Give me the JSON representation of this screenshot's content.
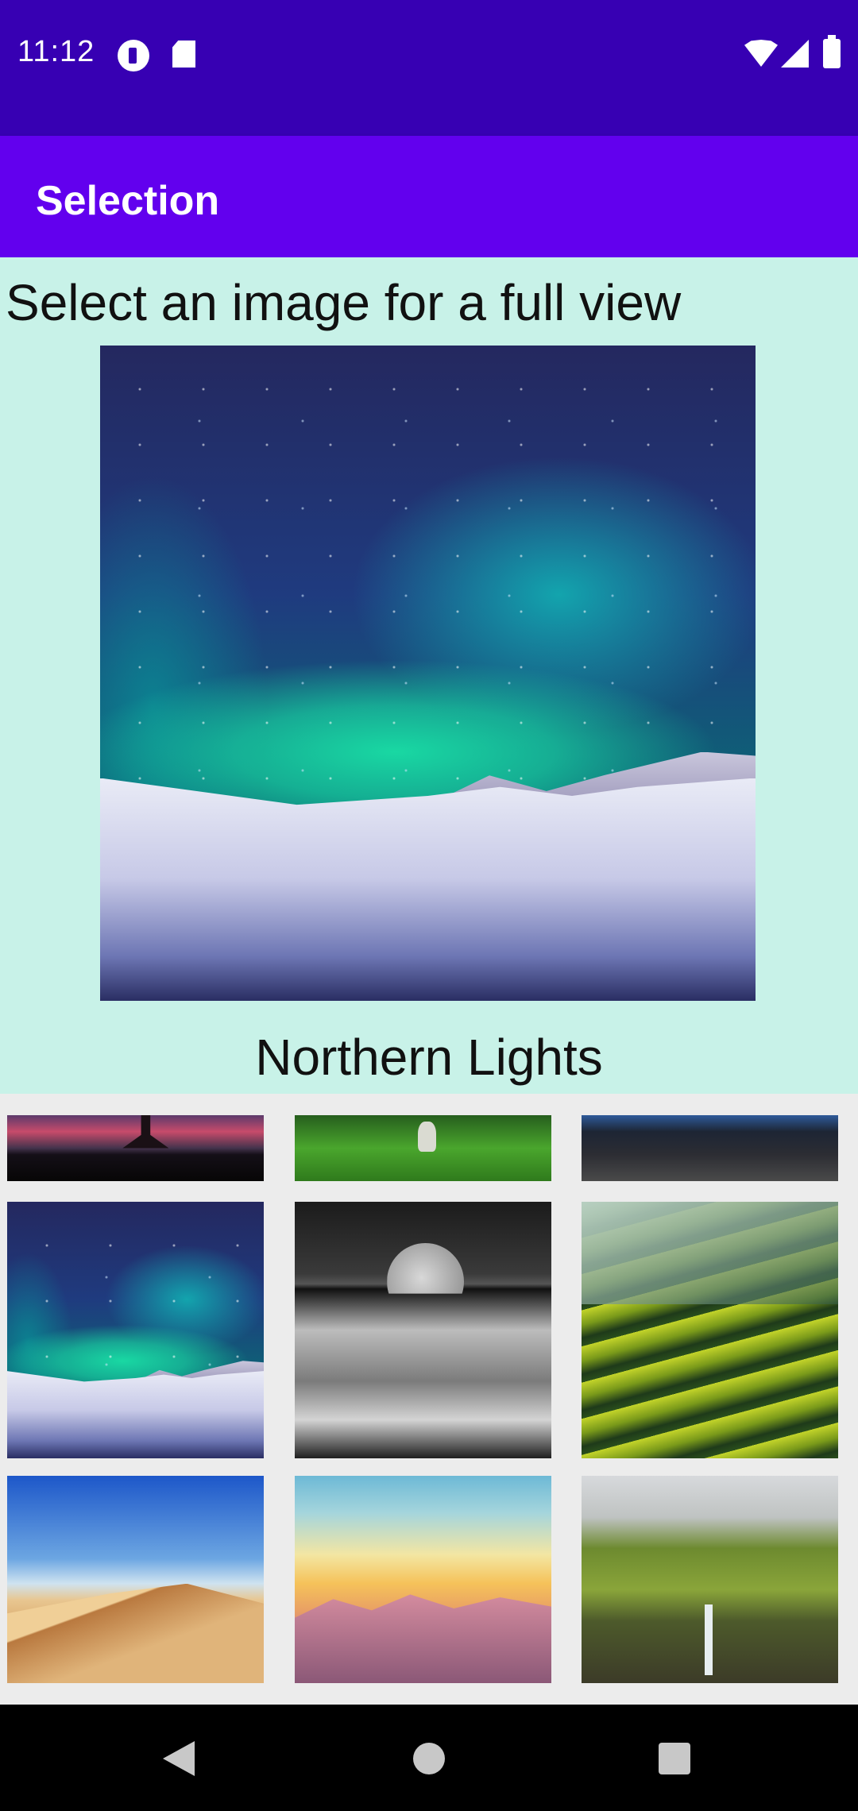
{
  "status_bar": {
    "time": "11:12",
    "icons": [
      "notification-app-icon",
      "sd-card-icon",
      "wifi-icon",
      "cell-signal-icon",
      "battery-icon"
    ]
  },
  "app_bar": {
    "title": "Selection",
    "color": "#6200ee",
    "status_color": "#3700b3"
  },
  "content": {
    "prompt": "Select an image for a full view",
    "selected_caption": "Northern Lights",
    "background": "#c8f2e8"
  },
  "gallery": {
    "rows": [
      [
        "sunset-silhouette",
        "green-forest",
        "rocky-shore"
      ],
      [
        "northern-lights",
        "moon-over-sea",
        "rice-terraces"
      ],
      [
        "desert-dunes",
        "pastel-mountains",
        "green-cliff-waterfall"
      ]
    ]
  },
  "nav_bar": {
    "icons": [
      "back-icon",
      "home-icon",
      "recents-icon"
    ]
  }
}
